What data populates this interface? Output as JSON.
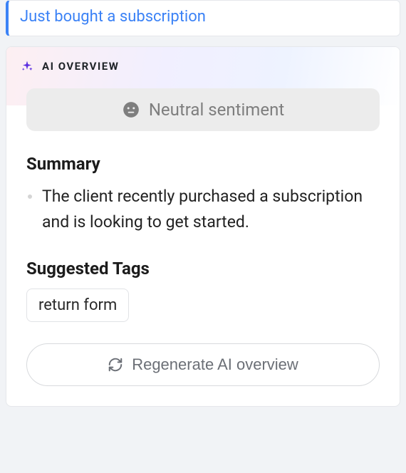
{
  "subject": {
    "text": "Just bought a subscription"
  },
  "overview": {
    "title": "AI OVERVIEW",
    "sentiment_label": "Neutral sentiment",
    "summary_heading": "Summary",
    "summary_items": [
      "The client recently purchased a subscription and is looking to get started."
    ],
    "tags_heading": "Suggested Tags",
    "tags": [
      "return form"
    ],
    "regenerate_label": "Regenerate AI overview"
  }
}
